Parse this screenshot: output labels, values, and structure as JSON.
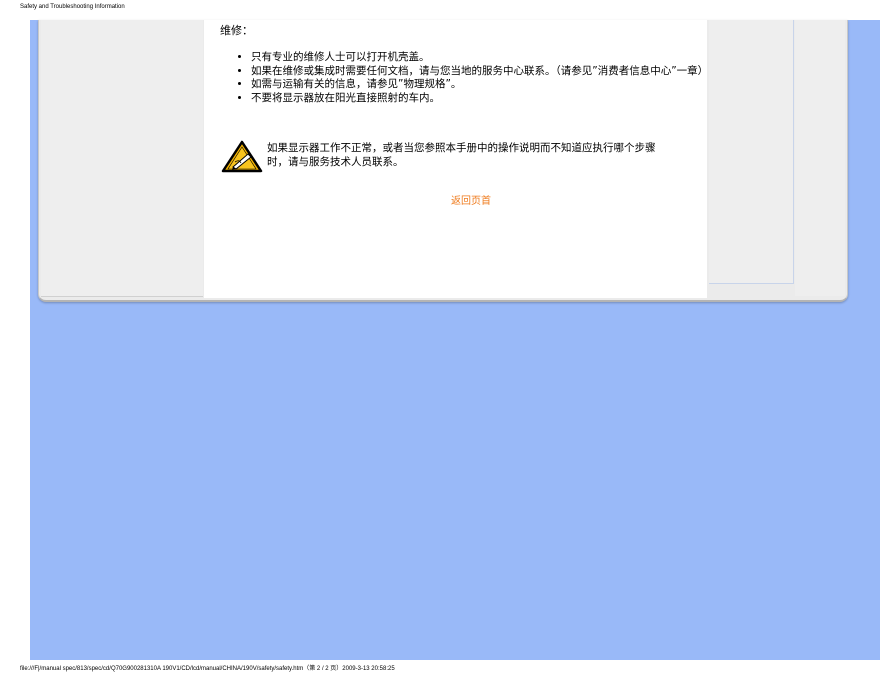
{
  "header": {
    "title": "Safety and Troubleshooting Information"
  },
  "content": {
    "section_title": "维修：",
    "rules": [
      "只有专业的维修人士可以打开机壳盖。",
      "如果在维修或集成时需要任何文档，请与您当地的服务中心联系。（请参见”消费者信息中心”一章）",
      "如需与运输有关的信息，请参见”物理规格”。",
      "不要将显示器放在阳光直接照射的车内。"
    ],
    "warning_text": "如果显示器工作不正常，或者当您参照本手册中的操作说明而不知道应执行哪个步骤时，请与服务技术人员联系。",
    "back_link": "返回页首",
    "warning_icon": "warning-triangle-icon"
  },
  "footer": {
    "path": "file:///F|/manual spec/813/spec/cd/Q70G900281310A 190V1/CD/lcd/manual/CHINA/190V/safety/safety.htm（第 2 / 2 页）2009-3-13 20:58:25"
  },
  "colors": {
    "background_blue": "#99b9f8",
    "link_orange": "#ef7b1d"
  }
}
